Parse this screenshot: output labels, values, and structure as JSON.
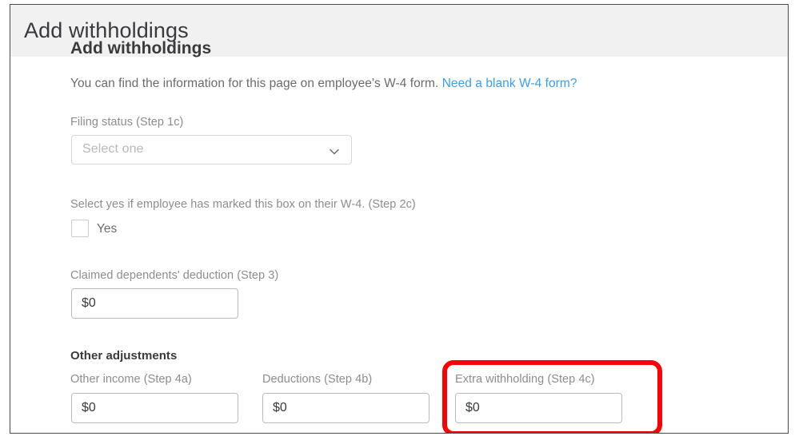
{
  "header": {
    "title": "Add withholdings"
  },
  "form": {
    "clipped_heading": "Add withholdings",
    "intro_text": "You can find the information for this page on employee's W-4 form.",
    "intro_link": "Need a blank W-4 form?",
    "filing_status": {
      "label": "Filing status (Step 1c)",
      "placeholder": "Select one",
      "value": "",
      "icon": "chevron-down-icon"
    },
    "marked_box": {
      "label": "Select yes if employee has marked this box on their W-4. (Step 2c)",
      "checkbox_label": "Yes",
      "checked": false
    },
    "dependents": {
      "label": "Claimed dependents' deduction (Step 3)",
      "value": "$0"
    },
    "other_adjustments": {
      "heading": "Other adjustments",
      "fields": [
        {
          "label": "Other income (Step 4a)",
          "value": "$0"
        },
        {
          "label": "Deductions (Step 4b)",
          "value": "$0"
        },
        {
          "label": "Extra withholding (Step 4c)",
          "value": "$0"
        }
      ]
    }
  },
  "annotation": {
    "color": "#fb0007",
    "target": "Extra withholding (Step 4c)"
  },
  "colors": {
    "header_background": "#f1f1f1",
    "title_text": "#393a3d",
    "label_text": "#8d8d8d",
    "body_text": "#6b6b6b",
    "link": "#3b9fe8",
    "input_border": "#b8bcc3",
    "select_border": "#d4d7dc",
    "placeholder": "#b6b9c0",
    "annotation_red": "#fb0007",
    "panel_border": "#4a4a4a"
  }
}
